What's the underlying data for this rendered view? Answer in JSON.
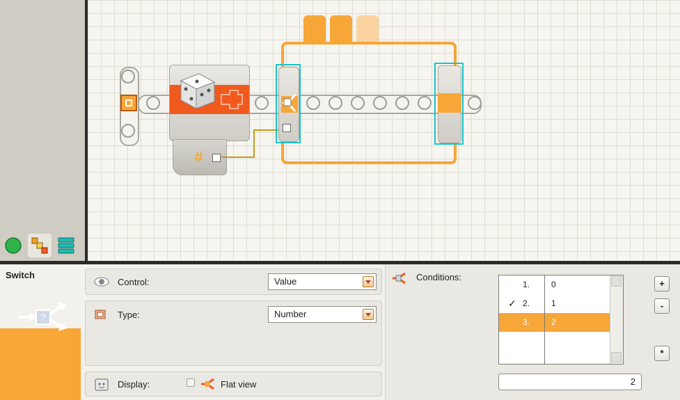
{
  "workspace": {
    "palette_tabs": [
      {
        "name": "common-palette",
        "icon": "green-circle-icon"
      },
      {
        "name": "complete-palette",
        "icon": "blocks-icon"
      },
      {
        "name": "custom-palette",
        "icon": "stack-icon"
      }
    ],
    "number_block_symbol": "#",
    "colors": {
      "accent": "#f7a638",
      "block_orange": "#f05a1f",
      "selection_cyan": "#19c3c6",
      "wire": "#c79a1b"
    }
  },
  "config": {
    "block_name": "Switch",
    "control": {
      "label": "Control:",
      "value": "Value"
    },
    "type": {
      "label": "Type:",
      "value": "Number"
    },
    "display": {
      "label": "Display:",
      "flat_view_label": "Flat view",
      "flat_view_checked": false
    },
    "conditions": {
      "label": "Conditions:",
      "rows": [
        {
          "check": "",
          "num": "1.",
          "value": "0"
        },
        {
          "check": "✓",
          "num": "2.",
          "value": "1"
        },
        {
          "check": "",
          "num": "3.",
          "value": "2"
        }
      ],
      "selected_index": 2,
      "input_value": "2",
      "buttons": {
        "add": "+",
        "remove": "-",
        "default": "*"
      }
    }
  }
}
